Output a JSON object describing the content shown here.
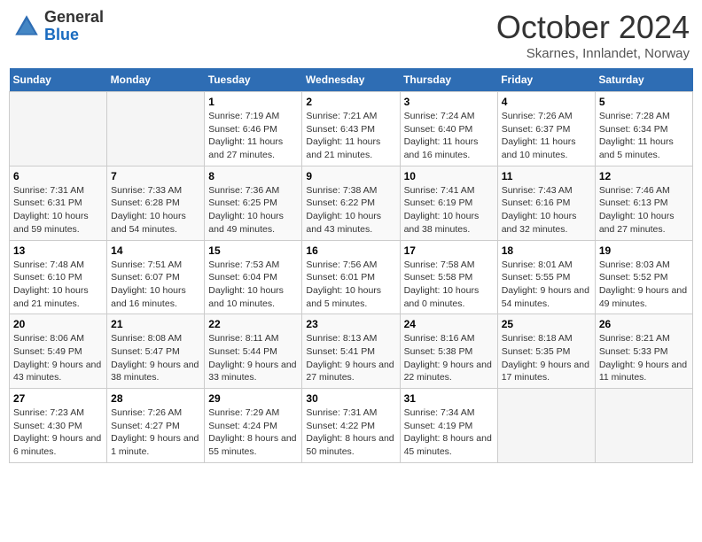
{
  "header": {
    "logo_general": "General",
    "logo_blue": "Blue",
    "month": "October 2024",
    "location": "Skarnes, Innlandet, Norway"
  },
  "days_of_week": [
    "Sunday",
    "Monday",
    "Tuesday",
    "Wednesday",
    "Thursday",
    "Friday",
    "Saturday"
  ],
  "weeks": [
    [
      {
        "day": "",
        "info": ""
      },
      {
        "day": "",
        "info": ""
      },
      {
        "day": "1",
        "info": "Sunrise: 7:19 AM\nSunset: 6:46 PM\nDaylight: 11 hours and 27 minutes."
      },
      {
        "day": "2",
        "info": "Sunrise: 7:21 AM\nSunset: 6:43 PM\nDaylight: 11 hours and 21 minutes."
      },
      {
        "day": "3",
        "info": "Sunrise: 7:24 AM\nSunset: 6:40 PM\nDaylight: 11 hours and 16 minutes."
      },
      {
        "day": "4",
        "info": "Sunrise: 7:26 AM\nSunset: 6:37 PM\nDaylight: 11 hours and 10 minutes."
      },
      {
        "day": "5",
        "info": "Sunrise: 7:28 AM\nSunset: 6:34 PM\nDaylight: 11 hours and 5 minutes."
      }
    ],
    [
      {
        "day": "6",
        "info": "Sunrise: 7:31 AM\nSunset: 6:31 PM\nDaylight: 10 hours and 59 minutes."
      },
      {
        "day": "7",
        "info": "Sunrise: 7:33 AM\nSunset: 6:28 PM\nDaylight: 10 hours and 54 minutes."
      },
      {
        "day": "8",
        "info": "Sunrise: 7:36 AM\nSunset: 6:25 PM\nDaylight: 10 hours and 49 minutes."
      },
      {
        "day": "9",
        "info": "Sunrise: 7:38 AM\nSunset: 6:22 PM\nDaylight: 10 hours and 43 minutes."
      },
      {
        "day": "10",
        "info": "Sunrise: 7:41 AM\nSunset: 6:19 PM\nDaylight: 10 hours and 38 minutes."
      },
      {
        "day": "11",
        "info": "Sunrise: 7:43 AM\nSunset: 6:16 PM\nDaylight: 10 hours and 32 minutes."
      },
      {
        "day": "12",
        "info": "Sunrise: 7:46 AM\nSunset: 6:13 PM\nDaylight: 10 hours and 27 minutes."
      }
    ],
    [
      {
        "day": "13",
        "info": "Sunrise: 7:48 AM\nSunset: 6:10 PM\nDaylight: 10 hours and 21 minutes."
      },
      {
        "day": "14",
        "info": "Sunrise: 7:51 AM\nSunset: 6:07 PM\nDaylight: 10 hours and 16 minutes."
      },
      {
        "day": "15",
        "info": "Sunrise: 7:53 AM\nSunset: 6:04 PM\nDaylight: 10 hours and 10 minutes."
      },
      {
        "day": "16",
        "info": "Sunrise: 7:56 AM\nSunset: 6:01 PM\nDaylight: 10 hours and 5 minutes."
      },
      {
        "day": "17",
        "info": "Sunrise: 7:58 AM\nSunset: 5:58 PM\nDaylight: 10 hours and 0 minutes."
      },
      {
        "day": "18",
        "info": "Sunrise: 8:01 AM\nSunset: 5:55 PM\nDaylight: 9 hours and 54 minutes."
      },
      {
        "day": "19",
        "info": "Sunrise: 8:03 AM\nSunset: 5:52 PM\nDaylight: 9 hours and 49 minutes."
      }
    ],
    [
      {
        "day": "20",
        "info": "Sunrise: 8:06 AM\nSunset: 5:49 PM\nDaylight: 9 hours and 43 minutes."
      },
      {
        "day": "21",
        "info": "Sunrise: 8:08 AM\nSunset: 5:47 PM\nDaylight: 9 hours and 38 minutes."
      },
      {
        "day": "22",
        "info": "Sunrise: 8:11 AM\nSunset: 5:44 PM\nDaylight: 9 hours and 33 minutes."
      },
      {
        "day": "23",
        "info": "Sunrise: 8:13 AM\nSunset: 5:41 PM\nDaylight: 9 hours and 27 minutes."
      },
      {
        "day": "24",
        "info": "Sunrise: 8:16 AM\nSunset: 5:38 PM\nDaylight: 9 hours and 22 minutes."
      },
      {
        "day": "25",
        "info": "Sunrise: 8:18 AM\nSunset: 5:35 PM\nDaylight: 9 hours and 17 minutes."
      },
      {
        "day": "26",
        "info": "Sunrise: 8:21 AM\nSunset: 5:33 PM\nDaylight: 9 hours and 11 minutes."
      }
    ],
    [
      {
        "day": "27",
        "info": "Sunrise: 7:23 AM\nSunset: 4:30 PM\nDaylight: 9 hours and 6 minutes."
      },
      {
        "day": "28",
        "info": "Sunrise: 7:26 AM\nSunset: 4:27 PM\nDaylight: 9 hours and 1 minute."
      },
      {
        "day": "29",
        "info": "Sunrise: 7:29 AM\nSunset: 4:24 PM\nDaylight: 8 hours and 55 minutes."
      },
      {
        "day": "30",
        "info": "Sunrise: 7:31 AM\nSunset: 4:22 PM\nDaylight: 8 hours and 50 minutes."
      },
      {
        "day": "31",
        "info": "Sunrise: 7:34 AM\nSunset: 4:19 PM\nDaylight: 8 hours and 45 minutes."
      },
      {
        "day": "",
        "info": ""
      },
      {
        "day": "",
        "info": ""
      }
    ]
  ]
}
